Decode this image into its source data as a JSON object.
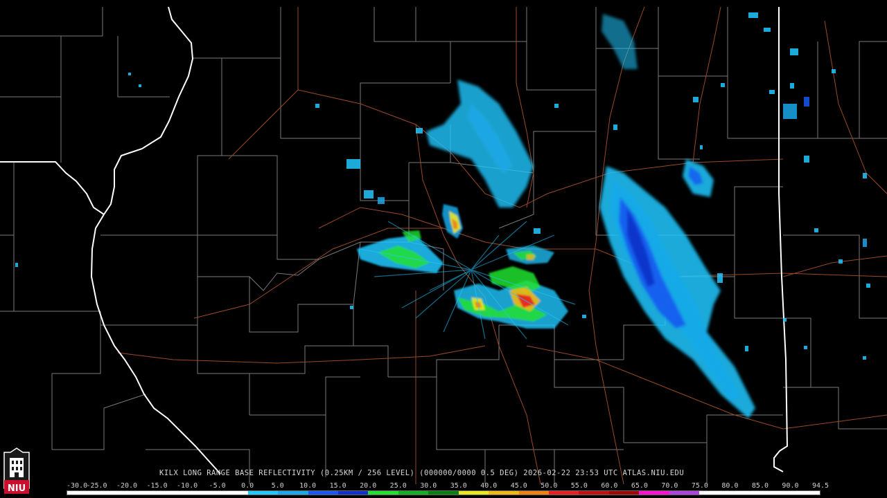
{
  "caption": "KILX LONG RANGE BASE REFLECTIVITY (0.25KM / 256 LEVEL) (000000/0000 0.5 DEG) 2026-02-22 23:53 UTC  ATLAS.NIU.EDU",
  "logo": {
    "text": "NIU",
    "colors": {
      "crest": "#c8102e",
      "shield": "#ffffff",
      "dark": "#1a1a1a"
    }
  },
  "scale": {
    "ticks": [
      "-30.0",
      "-25.0",
      "-20.0",
      "-15.0",
      "-10.0",
      "-5.0",
      "0.0",
      "5.0",
      "10.0",
      "15.0",
      "20.0",
      "25.0",
      "30.0",
      "35.0",
      "40.0",
      "45.0",
      "50.0",
      "55.0",
      "60.0",
      "65.0",
      "70.0",
      "75.0",
      "80.0",
      "85.0",
      "90.0",
      "94.5"
    ],
    "colors": [
      "#ffffff",
      "#ffffff",
      "#ffffff",
      "#ffffff",
      "#ffffff",
      "#ffffff",
      "#22c8ff",
      "#19a8e8",
      "#1858f0",
      "#1030c8",
      "#22e030",
      "#10b020",
      "#088010",
      "#e8e820",
      "#f0b810",
      "#f08010",
      "#e82020",
      "#c01010",
      "#a00808",
      "#ff10d0",
      "#b040e0",
      "#ffffff",
      "#ffffff",
      "#ffffff",
      "#ffffff"
    ]
  },
  "map": {
    "colors": {
      "county": "#7a7a7a",
      "highway": "#9a4a28",
      "state": "#ffffff"
    }
  }
}
